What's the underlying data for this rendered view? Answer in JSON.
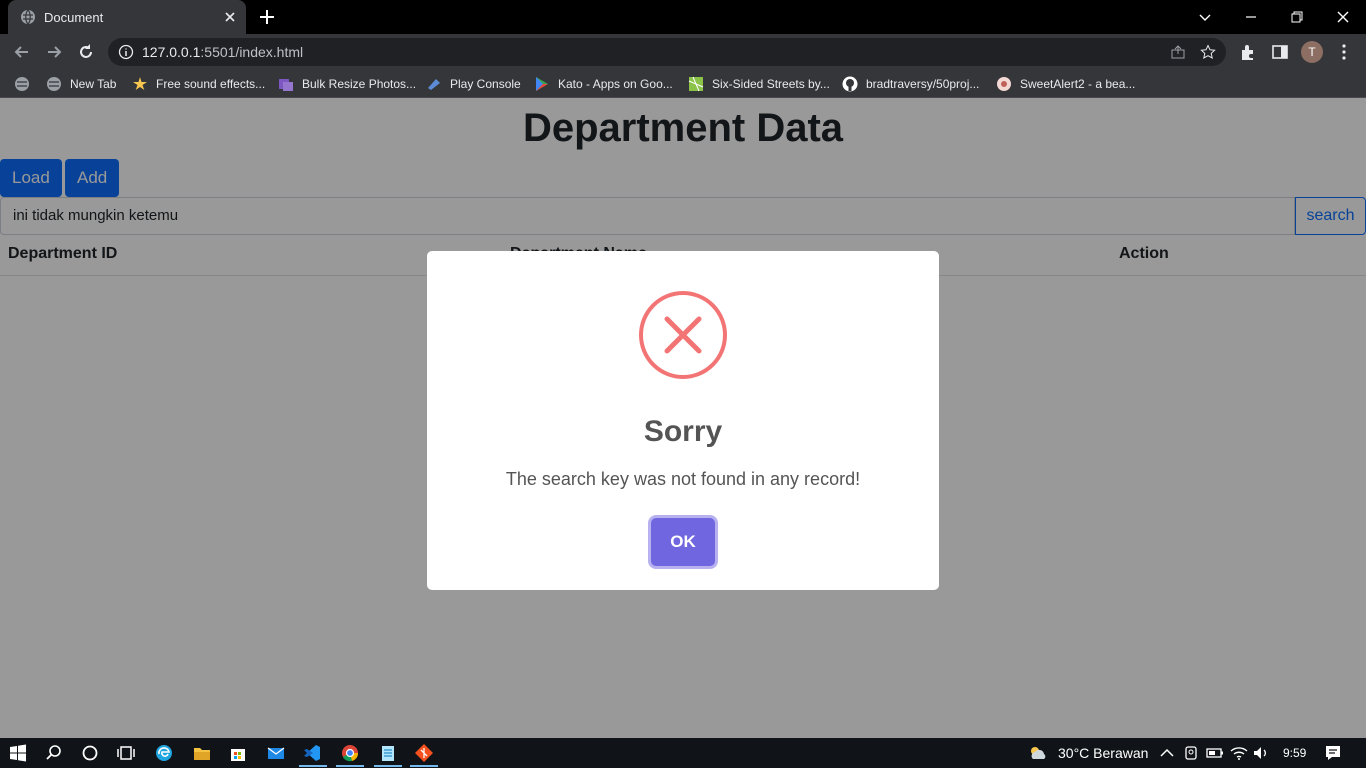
{
  "browser": {
    "tab_title": "Document",
    "url_host": "127.0.0.1",
    "url_rest": ":5501/index.html",
    "avatar_letter": "T",
    "bookmarks": [
      {
        "label": "",
        "icon": "globe-icon"
      },
      {
        "label": "New Tab",
        "icon": "globe-icon"
      },
      {
        "label": "Free sound effects...",
        "icon": "sound-icon"
      },
      {
        "label": "Bulk Resize Photos...",
        "icon": "photos-icon"
      },
      {
        "label": "Play Console",
        "icon": "play-console-icon"
      },
      {
        "label": "Kato - Apps on Goo...",
        "icon": "google-play-icon"
      },
      {
        "label": "Six-Sided Streets by...",
        "icon": "map-icon"
      },
      {
        "label": "bradtraversy/50proj...",
        "icon": "github-icon"
      },
      {
        "label": "SweetAlert2 - a bea...",
        "icon": "sweetalert-icon"
      }
    ]
  },
  "page": {
    "title": "Department Data",
    "load_label": "Load",
    "add_label": "Add",
    "search_value": "ini tidak mungkin ketemu",
    "search_button": "search",
    "columns": [
      "Department ID",
      "Department Name",
      "Action"
    ]
  },
  "modal": {
    "title": "Sorry",
    "text": "The search key was not found in any record!",
    "ok_label": "OK",
    "icon": "error-x-icon"
  },
  "taskbar": {
    "weather": "30°C  Berawan",
    "time": "9:59"
  },
  "colors": {
    "accent": "#0d6efd",
    "confirm": "#7066e0",
    "error": "#f27474"
  }
}
